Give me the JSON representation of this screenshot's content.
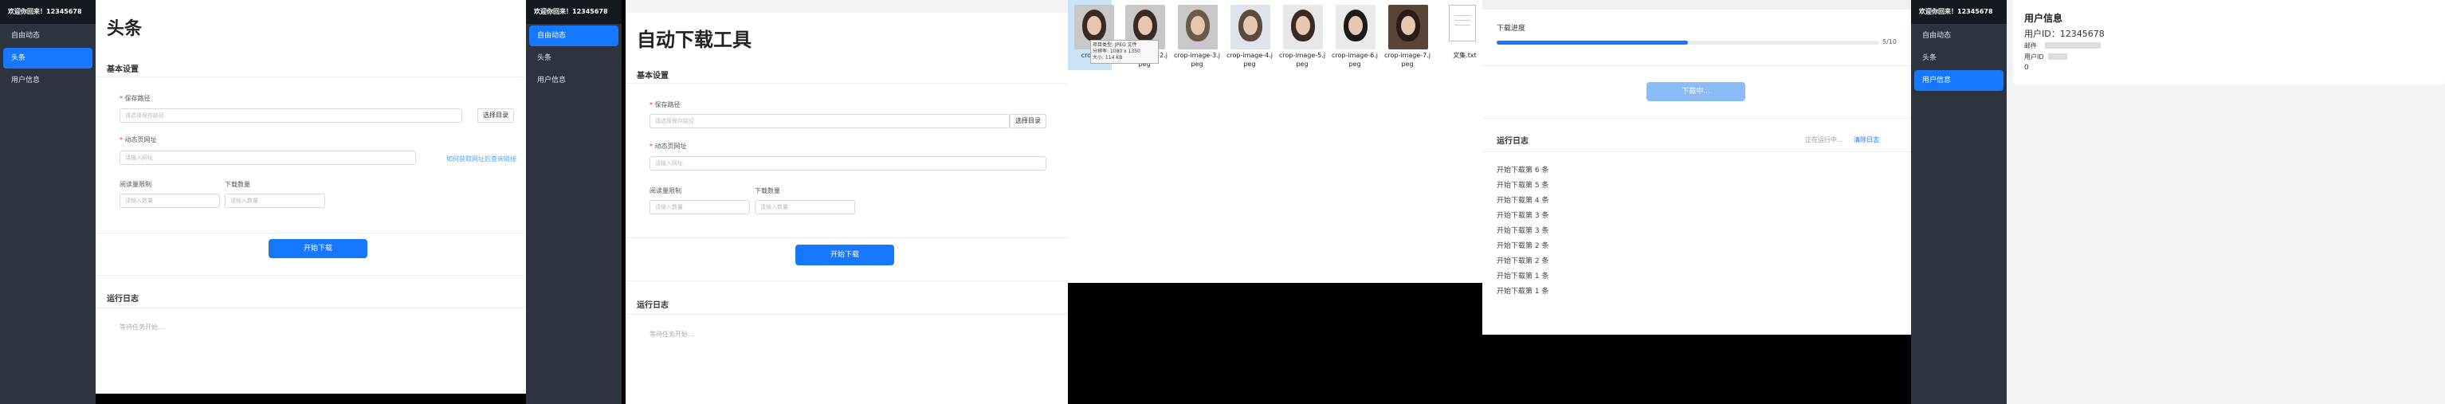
{
  "app": {
    "sidebar_title": "欢迎你回来！12345678",
    "nav": [
      "自由动态",
      "头条",
      "用户信息"
    ]
  },
  "panel1": {
    "page_title": "头条",
    "basic_settings": "基本设置",
    "save_path_label": "保存路径",
    "save_path_placeholder": "请选择保存路径",
    "choose_dir": "选择目录",
    "url_label": "动态页网址",
    "url_placeholder": "请输入网址",
    "url_help_link": "如何获取网址后查询链接",
    "read_limit_label": "阅读量限制",
    "read_limit_placeholder": "请输入数量",
    "download_count_label": "下载数量",
    "download_count_placeholder": "请输入数量",
    "start_button": "开始下载",
    "log_title": "运行日志",
    "log_placeholder": "等待任务开始..."
  },
  "panel2": {
    "page_title": "自动下载工具",
    "basic_settings": "基本设置",
    "save_path_label": "保存路径",
    "save_path_placeholder": "请选择保存路径",
    "choose_dir": "选择目录",
    "url_label": "动态页网址",
    "url_placeholder": "请输入网址",
    "read_limit_label": "阅读量限制",
    "read_limit_placeholder": "请输入数量",
    "download_count_label": "下载数量",
    "download_count_placeholder": "请输入数量",
    "start_button": "开始下载",
    "log_title": "运行日志",
    "log_placeholder": "等待任务开始..."
  },
  "panel3": {
    "files": [
      "crop-image-1.jpeg",
      "crop-image-2.jpeg",
      "crop-image-3.jpeg",
      "crop-image-4.jpeg",
      "crop-image-5.jpeg",
      "crop-image-6.jpeg",
      "crop-image-7.jpeg",
      "文集.txt"
    ],
    "file_labels": [
      "crop-i",
      "crop-image-2.j\npeg",
      "crop-image-3.j\npeg",
      "crop-image-4.j\npeg",
      "crop-image-5.j\npeg",
      "crop-image-6.j\npeg",
      "crop-image-7.j\npeg",
      "文集.txt"
    ],
    "tooltip": [
      "项目类型: JPEG 文件",
      "分辨率: 1080 x 1350",
      "大小: 114 KB"
    ]
  },
  "panel4": {
    "progress_label": "下载进度",
    "progress_text": "5/10",
    "progress_value": 0.5,
    "downloading_button": "下载中...",
    "log_title": "运行日志",
    "log_status": "正在运行中...",
    "clear_log": "清除日志",
    "log_lines": [
      "开始下载第 6 条",
      "开始下载第 5 条",
      "开始下载第 4 条",
      "开始下载第 3 条",
      "开始下载第 3 条",
      "开始下载第 2 条",
      "开始下载第 2 条",
      "开始下载第 1 条",
      "开始下载第 1 条"
    ]
  },
  "panel5": {
    "card_title": "用户信息",
    "user_id": "用户ID：12345678",
    "line2": "邮件",
    "line3": "用户ID",
    "line4": "0"
  }
}
